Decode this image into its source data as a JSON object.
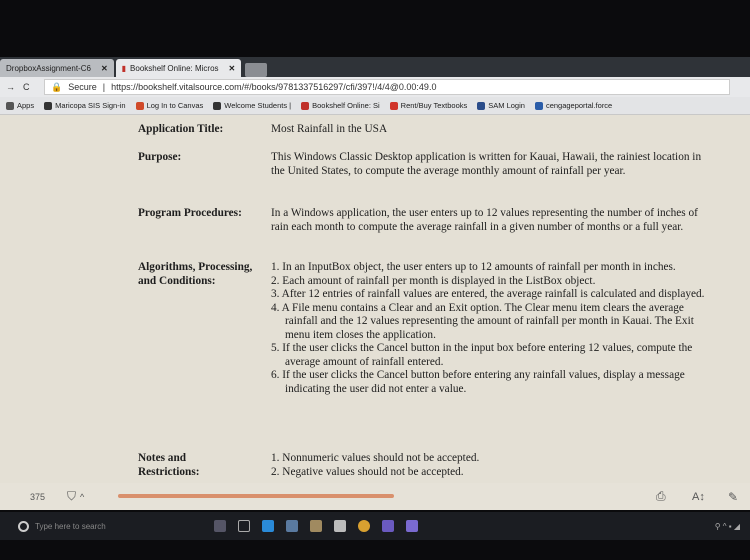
{
  "browser": {
    "tabs": [
      {
        "label": "DropboxAssignment-C6",
        "active": false
      },
      {
        "label": "Bookshelf Online: Micros",
        "active": true
      }
    ],
    "secure_label": "Secure",
    "url": "https://bookshelf.vitalsource.com/#/books/9781337516297/cfi/397!/4/4@0.00:49.0",
    "bookmarks": [
      {
        "label": "Apps",
        "color": "#555"
      },
      {
        "label": "Maricopa SIS Sign-in",
        "color": "#333"
      },
      {
        "label": "Log In to Canvas",
        "color": "#d04a2a"
      },
      {
        "label": "Welcome Students |",
        "color": "#333"
      },
      {
        "label": "Bookshelf Online: Si",
        "color": "#c0302a"
      },
      {
        "label": "Rent/Buy Textbooks",
        "color": "#d0332a"
      },
      {
        "label": "SAM Login",
        "color": "#2a4c8a"
      },
      {
        "label": "cengageportal.force",
        "color": "#2a5ca8"
      }
    ]
  },
  "content": {
    "rows": [
      {
        "label": "Application Title:",
        "text": "Most Rainfall in the USA"
      },
      {
        "label": "Purpose:",
        "text": "This Windows Classic Desktop application is written for Kauai, Hawaii, the rainiest location in the United States, to compute the average monthly amount of rainfall per year."
      },
      {
        "label": "Program Procedures:",
        "text": "In a Windows application, the user enters up to 12 values representing the number of inches of rain each month to compute the average rainfall in a given number of months or a full year."
      },
      {
        "label": "Algorithms, Processing, and Conditions:",
        "items": [
          "1. In an InputBox object, the user enters up to 12 amounts of rainfall per month in inches.",
          "2. Each amount of rainfall per month is displayed in the ListBox object.",
          "3. After 12 entries of rainfall values are entered, the average rainfall is calculated and displayed.",
          "4. A File menu contains a Clear and an Exit option. The Clear menu item clears the average rainfall and the 12 values representing the amount of rainfall per month in Kauai. The Exit menu item closes the application.",
          "5. If the user clicks the Cancel button in the input box before entering 12 values, compute the average amount of rainfall entered.",
          "6. If the user clicks the Cancel button before entering any rainfall values, display a message indicating the user did not enter a value."
        ]
      },
      {
        "label": "Notes and Restrictions:",
        "items": [
          "1. Nonnumeric values should not be accepted.",
          "2. Negative values should not be accepted."
        ]
      }
    ]
  },
  "reader": {
    "page_number": "375",
    "progress": 0.52,
    "progress_color": "#d9906c"
  },
  "taskbar": {
    "search_placeholder": "Type here to search"
  }
}
